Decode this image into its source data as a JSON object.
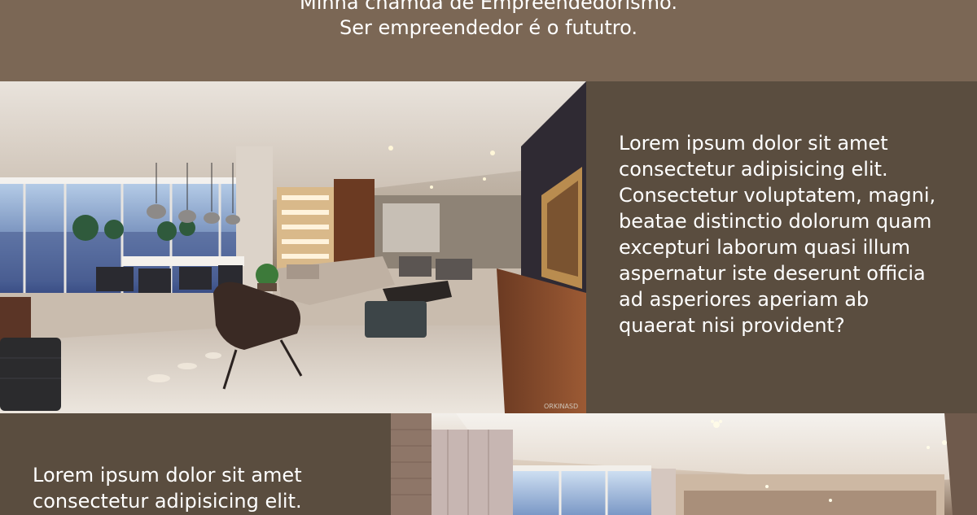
{
  "hero": {
    "line1": "Minha chamda de Empreendedorismo.",
    "line2": "Ser empreendedor é o fututro."
  },
  "sections": [
    {
      "image_name": "living-room-photo",
      "watermark": "ORKINASD",
      "paragraph": "Lorem ipsum dolor sit amet consectetur adipisicing elit. Consectetur voluptatem, magni, beatae distinctio dolorum quam excepturi laborum quasi illum aspernatur iste deserunt officia ad asperiores aperiam ab quaerat nisi provident?"
    },
    {
      "image_name": "bedroom-photo",
      "paragraph": "Lorem ipsum dolor sit amet consectetur adipisicing elit."
    }
  ],
  "colors": {
    "hero_bg": "#7b6755",
    "section_bg": "#5a4d3f",
    "text": "#ffffff"
  }
}
